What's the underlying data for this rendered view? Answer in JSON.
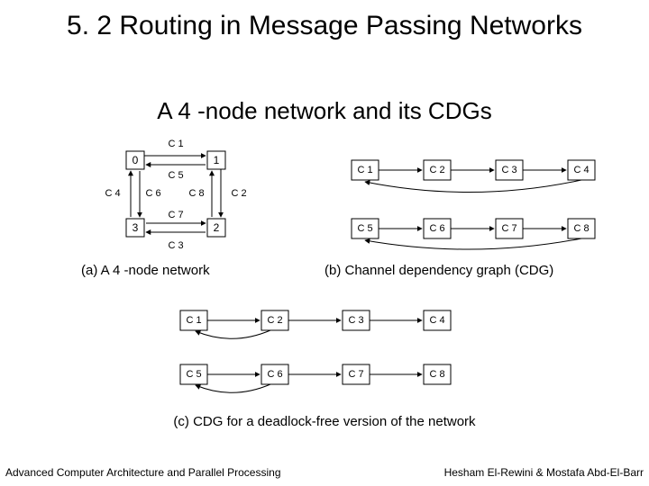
{
  "title": "5. 2 Routing in Message Passing Networks",
  "subtitle": "A 4 -node network and its CDGs",
  "captions": {
    "a": "(a) A 4 -node network",
    "b": "(b) Channel dependency graph (CDG)",
    "c": "(c) CDG for a deadlock-free version of the network"
  },
  "footer": {
    "left": "Advanced Computer Architecture and Parallel Processing",
    "right": "Hesham El-Rewini & Mostafa Abd-El-Barr"
  },
  "diagA": {
    "nodes": {
      "n0": "0",
      "n1": "1",
      "n2": "2",
      "n3": "3"
    },
    "channels": {
      "c1": "C 1",
      "c2": "C 2",
      "c3": "C 3",
      "c4": "C 4",
      "c5": "C 5",
      "c6": "C 6",
      "c7": "C 7",
      "c8": "C 8"
    }
  },
  "diagB": {
    "top": {
      "c1": "C 1",
      "c2": "C 2",
      "c3": "C 3",
      "c4": "C 4"
    },
    "bot": {
      "c5": "C 5",
      "c6": "C 6",
      "c7": "C 7",
      "c8": "C 8"
    }
  },
  "diagC": {
    "top": {
      "c1": "C 1",
      "c2": "C 2",
      "c3": "C 3",
      "c4": "C 4"
    },
    "bot": {
      "c5": "C 5",
      "c6": "C 6",
      "c7": "C 7",
      "c8": "C 8"
    }
  }
}
